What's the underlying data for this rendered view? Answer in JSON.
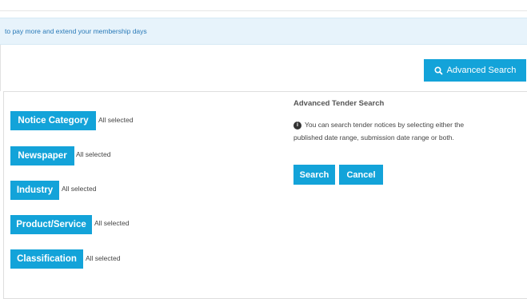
{
  "banner": {
    "text": "to pay more and extend your membership days"
  },
  "toolbar": {
    "advanced_search_label": "Advanced Search",
    "advanced_search_icon": "search-icon"
  },
  "filters": [
    {
      "label": "Notice Category",
      "status": "All selected"
    },
    {
      "label": "Newspaper",
      "status": "All selected"
    },
    {
      "label": "Industry",
      "status": "All selected"
    },
    {
      "label": "Product/Service",
      "status": "All selected"
    },
    {
      "label": "Classification",
      "status": "All selected"
    }
  ],
  "advanced": {
    "title": "Advanced Tender Search",
    "info_icon": "info-icon",
    "info_text": "You can search tender notices by selecting either the published date range, submission date range or both.",
    "search_label": "Search",
    "cancel_label": "Cancel"
  },
  "colors": {
    "accent": "#13a3d9",
    "banner_bg": "#e7f3fb",
    "banner_text": "#2a7ab8"
  }
}
